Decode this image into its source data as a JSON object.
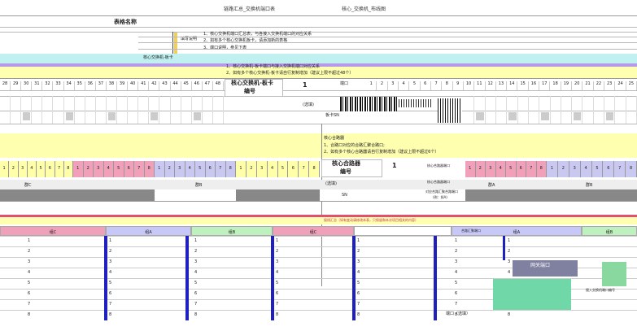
{
  "doc": {
    "header_text": "链路汇总_交换机端口表",
    "header_text_right": "核心_交换机_布线图",
    "title": "表格名称",
    "notes": [
      "1、核心交换机端口汇总表，与各接入交换机端口的对应关系",
      "2、如有多个核心交换机板卡，请添加新的表格",
      "3、端口说明，参见下表"
    ],
    "note_label": "填写说明"
  },
  "switch_section": {
    "band1_label": "核心交换机-板卡",
    "instr1": "1、核心交换机-板卡端口与接入交换机端口对应关系",
    "instr2": "2、如有多个核心交换机-板卡请自行复制增加（建议上限不超过48个）",
    "card_label": "核心交换机-板卡",
    "card_label2": "编号",
    "card_number": "1",
    "port_label": "端口",
    "optional_label": "(选填)",
    "sn_label": "板卡SN",
    "top_ports_left": [
      "28",
      "29",
      "30",
      "31",
      "32",
      "33",
      "34",
      "35",
      "36",
      "37",
      "38",
      "39",
      "40",
      "41",
      "42",
      "43",
      "44",
      "45",
      "46",
      "47",
      "48"
    ],
    "top_ports_right": [
      "1",
      "2",
      "3",
      "4",
      "5",
      "6",
      "7",
      "8",
      "9",
      "10",
      "11",
      "12",
      "13",
      "14",
      "15",
      "16",
      "17",
      "18",
      "19",
      "20",
      "21",
      "22",
      "23",
      "24",
      "25"
    ]
  },
  "router_section": {
    "title": "核心合路器",
    "instr1": "1、合路口对应的合路汇聚合路口;",
    "instr2": "2、如有多个核心合路器请自行复制增加（建议上限不超过6个）",
    "label": "核心合路器",
    "label2": "编号",
    "number": "1",
    "optional": "(选填)",
    "sn": "SN",
    "port_a": "核心合路器端口",
    "port_b": "核心合路器端口",
    "port_c": "对应合路汇聚合路端口",
    "port_c2": "(例：如A)",
    "ports": [
      "1",
      "2",
      "3",
      "4",
      "5",
      "6",
      "7",
      "8"
    ],
    "group_left": [
      "群C",
      "群B",
      "群A"
    ],
    "group_right": [
      "群A",
      "群B"
    ]
  },
  "bottom_section": {
    "band_text": "接线汇总（如有变动请修改本表，只保留和本次项目相关的内容）",
    "headers": [
      "组C",
      "组A",
      "组B",
      "组C",
      "",
      "组A",
      "组B"
    ],
    "agg_label": "合路汇聚端口",
    "rows": [
      "1",
      "2",
      "3",
      "4",
      "5",
      "6",
      "7",
      "8"
    ],
    "optional": "端口（选填）",
    "gate_label": "网关端口",
    "side_label": "接入交换机端口编号"
  },
  "colors": {
    "yellow": "#ffffaa",
    "cyan": "#b8f0f0",
    "purple": "#c8a8f0",
    "green": "#bff0bf",
    "pink": "#f0a0b8",
    "red": "#e05060",
    "lavender": "#c8c8f0",
    "blue": "#2020c0"
  }
}
